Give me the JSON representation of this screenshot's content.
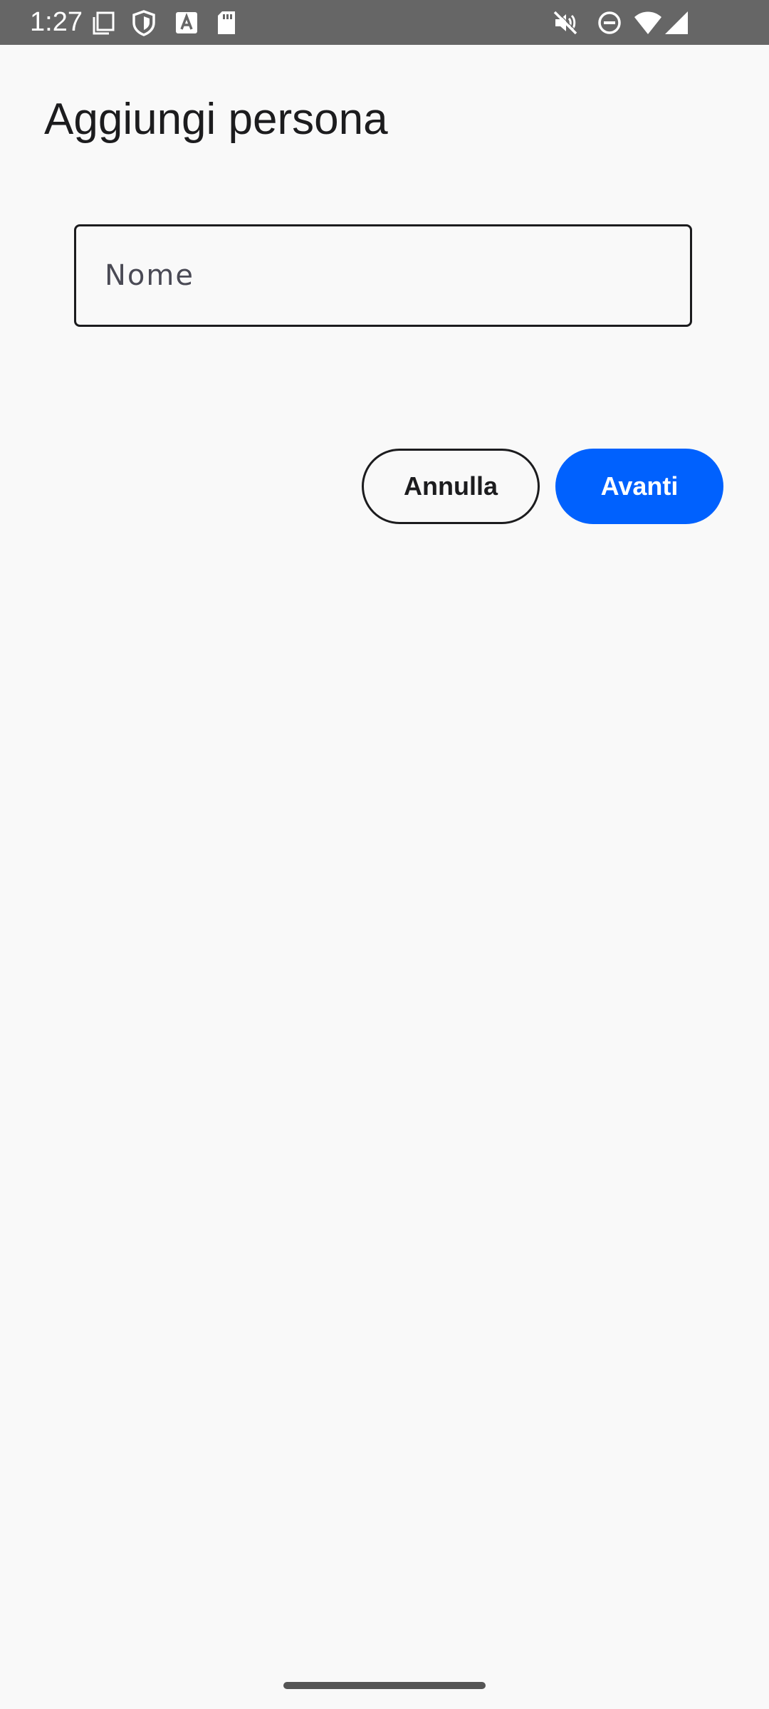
{
  "status_bar": {
    "time": "1:27",
    "icons": [
      "screenshot-icon",
      "shield-icon",
      "font-a-icon",
      "sd-card-icon",
      "mute-icon",
      "do-not-disturb-icon",
      "wifi-icon",
      "cell-signal-icon"
    ]
  },
  "page": {
    "title": "Aggiungi persona"
  },
  "form": {
    "name_value": "",
    "name_placeholder": "Nome"
  },
  "actions": {
    "cancel_label": "Annulla",
    "next_label": "Avanti"
  },
  "colors": {
    "accent": "#0061fe",
    "background": "#f9f9f9",
    "status_bar": "#666666"
  }
}
